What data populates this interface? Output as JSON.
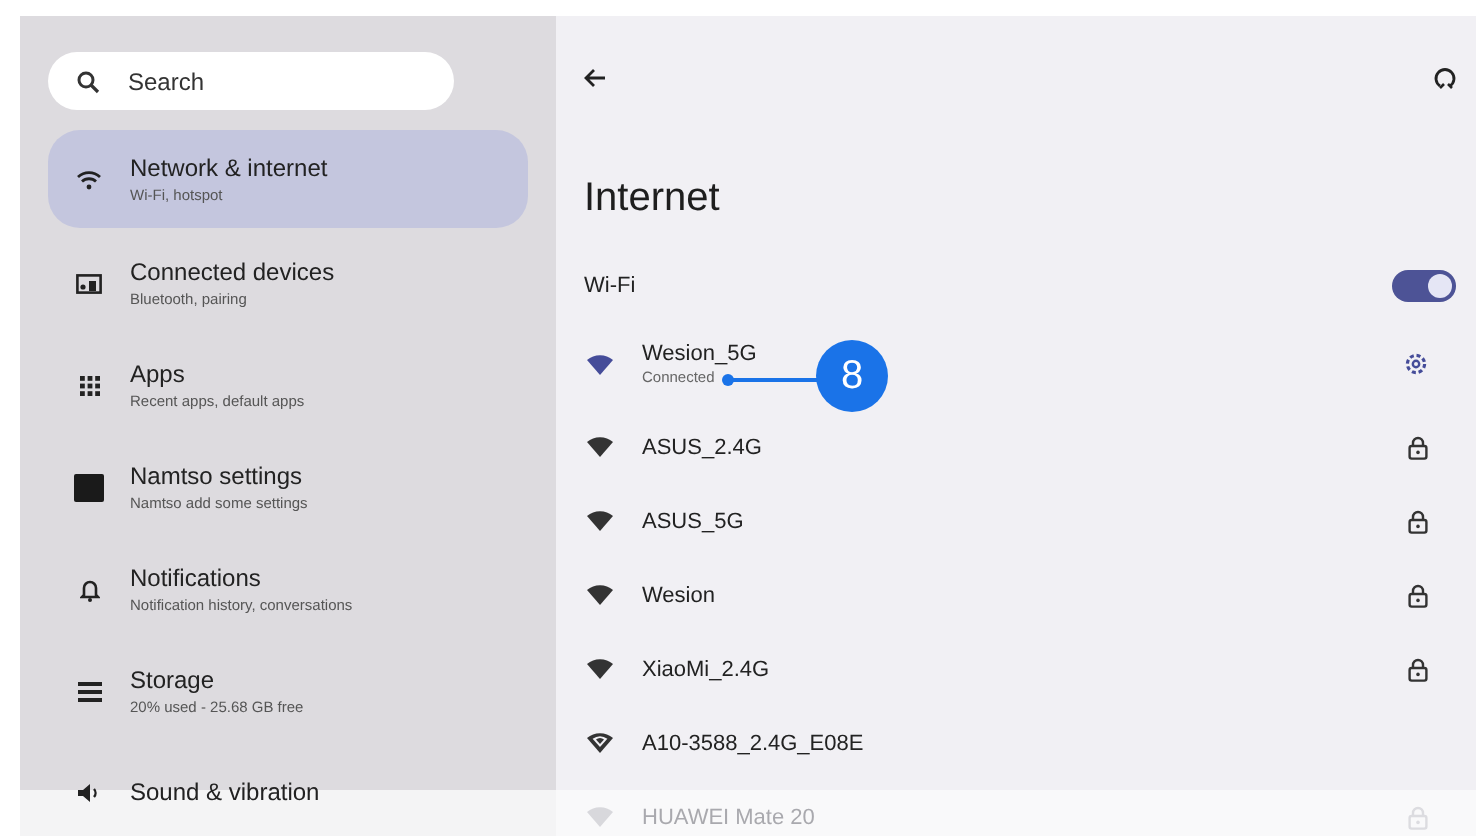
{
  "sidebar": {
    "search": {
      "placeholder": "Search"
    },
    "items": [
      {
        "kind": "wifi",
        "title": "Network & internet",
        "subtitle": "Wi-Fi, hotspot",
        "selected": true
      },
      {
        "kind": "devices",
        "title": "Connected devices",
        "subtitle": "Bluetooth, pairing",
        "selected": false
      },
      {
        "kind": "apps",
        "title": "Apps",
        "subtitle": "Recent apps, default apps",
        "selected": false
      },
      {
        "kind": "custom",
        "title": "Namtso settings",
        "subtitle": "Namtso add some settings",
        "selected": false
      },
      {
        "kind": "notifications",
        "title": "Notifications",
        "subtitle": "Notification history, conversations",
        "selected": false
      },
      {
        "kind": "storage",
        "title": "Storage",
        "subtitle": "20% used - 25.68 GB free",
        "selected": false
      },
      {
        "kind": "sound",
        "title": "Sound & vibration",
        "selected": false
      }
    ]
  },
  "panel": {
    "title": "Internet",
    "wifi": {
      "label": "Wi-Fi",
      "on": true
    },
    "networks": [
      {
        "kind": "connected",
        "name": "Wesion_5G",
        "status": "Connected",
        "dimmed": false
      },
      {
        "kind": "secured",
        "name": "ASUS_2.4G",
        "dimmed": false
      },
      {
        "kind": "secured",
        "name": "ASUS_5G",
        "dimmed": false
      },
      {
        "kind": "secured",
        "name": "Wesion",
        "dimmed": false
      },
      {
        "kind": "secured",
        "name": "XiaoMi_2.4G",
        "dimmed": false
      },
      {
        "kind": "open",
        "name": "A10-3588_2.4G_E08E",
        "dimmed": false
      },
      {
        "kind": "secured",
        "name": "HUAWEI Mate 20",
        "dimmed": true
      }
    ]
  },
  "callout": {
    "number": "8"
  }
}
